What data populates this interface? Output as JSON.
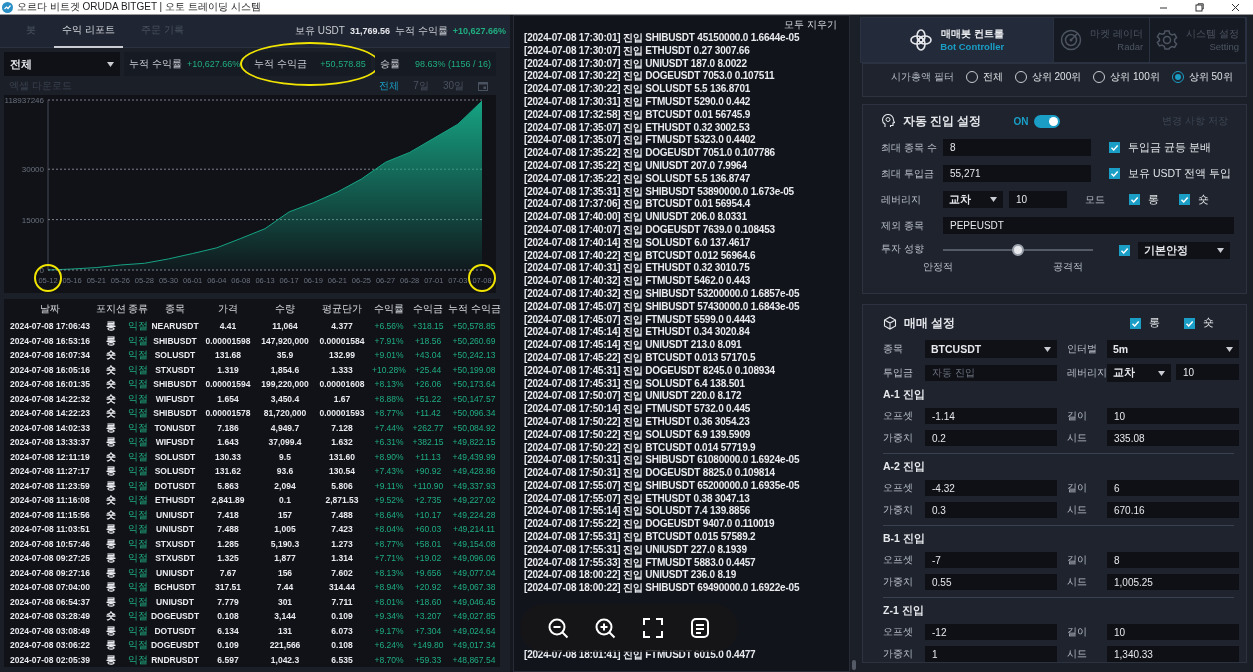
{
  "window": {
    "title": "오르다 비트겟 ORUDA BITGET | 오토 트레이딩 시스템",
    "controls": [
      {
        "kind": "minimize"
      },
      {
        "kind": "maximize"
      },
      {
        "kind": "close"
      }
    ]
  },
  "report": {
    "tabs": [
      {
        "label": "봇",
        "selected": false
      },
      {
        "label": "수익 리포트",
        "selected": true
      },
      {
        "label": "주문 기록",
        "selected": false
      }
    ],
    "balance": {
      "label": "보유 USDT",
      "value": "31,769.56"
    },
    "total_return": {
      "label": "누적 수익률",
      "value": "+10,627.66%"
    },
    "filter": {
      "value": "전체"
    },
    "stats": [
      {
        "label": "누적 수익률",
        "value": "+10,627.66%",
        "circled": false
      },
      {
        "label": "누적 수익금",
        "value": "+50,578.85",
        "circled": true
      },
      {
        "label": "승률",
        "value": "98.63% (1156 / 16)",
        "circled": false
      }
    ],
    "export_link": "엑셀 다운로드",
    "ranges": [
      {
        "label": "전체",
        "selected": true
      },
      {
        "label": "7일",
        "selected": false
      },
      {
        "label": "30일",
        "selected": false
      }
    ],
    "chart_data": {
      "type": "area",
      "categories": [
        "05-12",
        "05-16",
        "05-21",
        "05-26",
        "05-28",
        "05-30",
        "06-01",
        "06-04",
        "06-08",
        "06-13",
        "06-17",
        "06-19",
        "06-21",
        "06-25",
        "06-27",
        "06-28",
        "07-01",
        "07-03",
        "07-08"
      ],
      "series": [
        {
          "color": "#16a383",
          "values": [
            0,
            300,
            700,
            1500,
            2000,
            3300,
            4900,
            6600,
            9400,
            12300,
            17300,
            20000,
            23200,
            27100,
            32100,
            35000,
            39200,
            43400,
            50300
          ]
        }
      ],
      "ylim": [
        0,
        50600
      ],
      "yticks": [
        0,
        15000,
        30000
      ]
    },
    "chart_top_label": "118937246",
    "x_label_marks": [
      {
        "circled": true
      },
      {
        "circled": false
      },
      {
        "circled": false
      },
      {
        "circled": false
      },
      {
        "circled": false
      },
      {
        "circled": false
      },
      {
        "circled": false
      },
      {
        "circled": false
      },
      {
        "circled": false
      },
      {
        "circled": false
      },
      {
        "circled": false
      },
      {
        "circled": false
      },
      {
        "circled": false
      },
      {
        "circled": false
      },
      {
        "circled": false
      },
      {
        "circled": false
      },
      {
        "circled": false
      },
      {
        "circled": false
      },
      {
        "circled": true
      }
    ],
    "table": {
      "columns": [
        {
          "label": "날짜",
          "kind": "plain"
        },
        {
          "label": "포지션",
          "kind": "plain"
        },
        {
          "label": "종류",
          "kind": "profit"
        },
        {
          "label": "종목",
          "kind": "plain"
        },
        {
          "label": "가격",
          "kind": "plain"
        },
        {
          "label": "수량",
          "kind": "plain"
        },
        {
          "label": "평균단가",
          "kind": "plain"
        },
        {
          "label": "수익률",
          "kind": "profit"
        },
        {
          "label": "수익금",
          "kind": "profit"
        },
        {
          "label": "누적 수익금",
          "kind": "profit"
        }
      ],
      "rows": [
        [
          "2024-07-08 17:06:43",
          "롱",
          "익절",
          "NEARUSDT",
          "4.41",
          "11,064",
          "4.377",
          "+6.56%",
          "+318.15",
          "+50,578.85"
        ],
        [
          "2024-07-08 16:53:16",
          "롱",
          "익절",
          "SHIBUSDT",
          "0.00001598",
          "147,920,000",
          "0.00001584",
          "+7.91%",
          "+18.56",
          "+50,260.69"
        ],
        [
          "2024-07-08 16:07:34",
          "숏",
          "익절",
          "SOLUSDT",
          "131.68",
          "35.9",
          "132.99",
          "+9.01%",
          "+43.04",
          "+50,242.13"
        ],
        [
          "2024-07-08 16:05:16",
          "숏",
          "익절",
          "STXUSDT",
          "1.319",
          "1,854.6",
          "1.333",
          "+10.28%",
          "+25.44",
          "+50,199.08"
        ],
        [
          "2024-07-08 16:01:35",
          "숏",
          "익절",
          "SHIBUSDT",
          "0.00001594",
          "199,220,000",
          "0.00001608",
          "+8.13%",
          "+26.06",
          "+50,173.64"
        ],
        [
          "2024-07-08 14:22:32",
          "숏",
          "익절",
          "WIFUSDT",
          "1.654",
          "3,450.4",
          "1.67",
          "+8.88%",
          "+51.22",
          "+50,147.57"
        ],
        [
          "2024-07-08 14:22:23",
          "숏",
          "익절",
          "SHIBUSDT",
          "0.00001578",
          "81,720,000",
          "0.00001593",
          "+8.77%",
          "+11.42",
          "+50,096.34"
        ],
        [
          "2024-07-08 14:02:33",
          "롱",
          "익절",
          "TONUSDT",
          "7.186",
          "4,949.7",
          "7.128",
          "+7.44%",
          "+262.77",
          "+50,084.92"
        ],
        [
          "2024-07-08 13:33:37",
          "롱",
          "익절",
          "WIFUSDT",
          "1.643",
          "37,099.4",
          "1.632",
          "+6.31%",
          "+382.15",
          "+49,822.15"
        ],
        [
          "2024-07-08 12:11:19",
          "숏",
          "익절",
          "SOLUSDT",
          "130.33",
          "9.5",
          "131.60",
          "+8.90%",
          "+11.13",
          "+49,439.99"
        ],
        [
          "2024-07-08 11:27:17",
          "롱",
          "익절",
          "SOLUSDT",
          "131.62",
          "93.6",
          "130.54",
          "+7.43%",
          "+90.92",
          "+49,428.86"
        ],
        [
          "2024-07-08 11:23:59",
          "롱",
          "익절",
          "DOTUSDT",
          "5.863",
          "2,094",
          "5.806",
          "+9.11%",
          "+110.90",
          "+49,337.93"
        ],
        [
          "2024-07-08 11:16:08",
          "숏",
          "익절",
          "ETHUSDT",
          "2,841.89",
          "0.1",
          "2,871.53",
          "+9.52%",
          "+2.735",
          "+49,227.02"
        ],
        [
          "2024-07-08 11:15:56",
          "숏",
          "익절",
          "UNIUSDT",
          "7.418",
          "157",
          "7.488",
          "+8.64%",
          "+10.17",
          "+49,224.28"
        ],
        [
          "2024-07-08 11:03:51",
          "롱",
          "익절",
          "UNIUSDT",
          "7.488",
          "1,005",
          "7.423",
          "+8.04%",
          "+60.03",
          "+49,214.11"
        ],
        [
          "2024-07-08 10:57:46",
          "롱",
          "익절",
          "STXUSDT",
          "1.285",
          "5,190.3",
          "1.273",
          "+8.77%",
          "+58.01",
          "+49,154.08"
        ],
        [
          "2024-07-08 09:27:25",
          "롱",
          "익절",
          "STXUSDT",
          "1.325",
          "1,877",
          "1.314",
          "+7.71%",
          "+19.02",
          "+49,096.06"
        ],
        [
          "2024-07-08 09:27:16",
          "롱",
          "익절",
          "UNIUSDT",
          "7.67",
          "156",
          "7.602",
          "+8.13%",
          "+9.656",
          "+49,077.04"
        ],
        [
          "2024-07-08 07:04:00",
          "롱",
          "익절",
          "BCHUSDT",
          "317.51",
          "7.44",
          "314.44",
          "+8.94%",
          "+20.92",
          "+49,067.38"
        ],
        [
          "2024-07-08 06:54:37",
          "롱",
          "익절",
          "UNIUSDT",
          "7.779",
          "301",
          "7.711",
          "+8.01%",
          "+18.60",
          "+49,046.45"
        ],
        [
          "2024-07-08 03:28:49",
          "숏",
          "익절",
          "DOGEUSDT",
          "0.108",
          "3,144",
          "0.109",
          "+9.34%",
          "+3.207",
          "+49,027.85"
        ],
        [
          "2024-07-08 03:08:49",
          "롱",
          "익절",
          "DOTUSDT",
          "6.134",
          "131",
          "6.073",
          "+9.17%",
          "+7.304",
          "+49,024.64"
        ],
        [
          "2024-07-08 03:06:22",
          "롱",
          "익절",
          "DOGEUSDT",
          "0.109",
          "221,566",
          "0.108",
          "+6.24%",
          "+149.80",
          "+49,017.34"
        ],
        [
          "2024-07-08 02:05:39",
          "롱",
          "익절",
          "RNDRUSDT",
          "6.597",
          "1,042.3",
          "6.535",
          "+8.70%",
          "+59.33",
          "+48,867.54"
        ]
      ]
    }
  },
  "log": {
    "clear_button": "모두 지우기",
    "lines": [
      "[2024-07-08 17:30:01] 진입 SHIBUSDT 45150000.0 1.6644e-05",
      "[2024-07-08 17:30:07] 진입 ETHUSDT 0.27 3007.66",
      "[2024-07-08 17:30:07] 진입 UNIUSDT 187.0 8.0022",
      "[2024-07-08 17:30:22] 진입 DOGEUSDT 7053.0 0.107511",
      "[2024-07-08 17:30:22] 진입 SOLUSDT 5.5 136.8701",
      "[2024-07-08 17:30:31] 진입 FTMUSDT 5290.0 0.442",
      "[2024-07-08 17:32:58] 진입 BTCUSDT 0.01 56745.9",
      "[2024-07-08 17:35:07] 진입 ETHUSDT 0.32 3002.53",
      "[2024-07-08 17:35:07] 진입 FTMUSDT 5323.0 0.4402",
      "[2024-07-08 17:35:22] 진입 DOGEUSDT 7051.0 0.107786",
      "[2024-07-08 17:35:22] 진입 UNIUSDT 207.0 7.9964",
      "[2024-07-08 17:35:22] 진입 SOLUSDT 5.5 136.8747",
      "[2024-07-08 17:35:31] 진입 SHIBUSDT 53890000.0 1.673e-05",
      "[2024-07-08 17:37:06] 진입 BTCUSDT 0.01 56954.4",
      "[2024-07-08 17:40:00] 진입 UNIUSDT 206.0 8.0331",
      "[2024-07-08 17:40:07] 진입 DOGEUSDT 7639.0 0.108453",
      "[2024-07-08 17:40:14] 진입 SOLUSDT 6.0 137.4617",
      "[2024-07-08 17:40:22] 진입 BTCUSDT 0.012 56964.6",
      "[2024-07-08 17:40:31] 진입 ETHUSDT 0.32 3010.75",
      "[2024-07-08 17:40:32] 진입 FTMUSDT 5462.0 0.443",
      "[2024-07-08 17:40:32] 진입 SHIBUSDT 53200000.0 1.6857e-05",
      "[2024-07-08 17:45:07] 진입 SHIBUSDT 57430000.0 1.6843e-05",
      "[2024-07-08 17:45:07] 진입 FTMUSDT 5599.0 0.4443",
      "[2024-07-08 17:45:14] 진입 ETHUSDT 0.34 3020.84",
      "[2024-07-08 17:45:14] 진입 UNIUSDT 213.0 8.091",
      "[2024-07-08 17:45:22] 진입 BTCUSDT 0.013 57170.5",
      "[2024-07-08 17:45:31] 진입 DOGEUSDT 8245.0 0.108934",
      "[2024-07-08 17:45:31] 진입 SOLUSDT 6.4 138.501",
      "[2024-07-08 17:50:07] 진입 UNIUSDT 220.0 8.172",
      "[2024-07-08 17:50:14] 진입 FTMUSDT 5732.0 0.445",
      "[2024-07-08 17:50:22] 진입 ETHUSDT 0.36 3054.23",
      "[2024-07-08 17:50:22] 진입 SOLUSDT 6.9 139.5909",
      "[2024-07-08 17:50:22] 진입 BTCUSDT 0.014 57719.9",
      "[2024-07-08 17:50:31] 진입 SHIBUSDT 61080000.0 1.6924e-05",
      "[2024-07-08 17:50:31] 진입 DOGEUSDT 8825.0 0.109814",
      "[2024-07-08 17:55:07] 진입 SHIBUSDT 65200000.0 1.6935e-05",
      "[2024-07-08 17:55:07] 진입 ETHUSDT 0.38 3047.13",
      "[2024-07-08 17:55:14] 진입 SOLUSDT 7.4 139.8856",
      "[2024-07-08 17:55:22] 진입 DOGEUSDT 9407.0 0.110019",
      "[2024-07-08 17:55:31] 진입 BTCUSDT 0.015 57589.2",
      "[2024-07-08 17:55:31] 진입 UNIUSDT 227.0 8.1939",
      "[2024-07-08 17:55:33] 진입 FTMUSDT 5883.0 0.4457",
      "[2024-07-08 18:00:22] 진입 UNIUSDT 236.0 8.19",
      "[2024-07-08 18:00:22] 진입 SHIBUSDT 69490000.0 1.6922e-05",
      "[2024-07-08 18:01:41] 진입 FTMUSDT 6015.0 0.4477"
    ]
  },
  "viewer_toolbar": [
    {
      "kind": "zoom-out"
    },
    {
      "kind": "zoom-in"
    },
    {
      "kind": "fullscreen"
    },
    {
      "kind": "notes"
    }
  ],
  "controller": {
    "nav": [
      {
        "title": "매매봇 컨트롤",
        "subtitle": "Bot Controller",
        "selected": true
      },
      {
        "title": "마켓 레이더",
        "subtitle": "Radar",
        "selected": false
      },
      {
        "title": "시스템 설정",
        "subtitle": "Setting",
        "selected": false
      }
    ],
    "market_cap_filter": {
      "label": "시가총액 필터",
      "options": [
        {
          "label": "전체",
          "selected": false
        },
        {
          "label": "상위 200위",
          "selected": false
        },
        {
          "label": "상위 100위",
          "selected": false
        },
        {
          "label": "상위 50위",
          "selected": true
        }
      ]
    },
    "auto_entry": {
      "title": "자동 진입 설정",
      "toggle": {
        "label": "ON",
        "on": true
      },
      "save_button": "변경 사항 저장",
      "max_symbols": {
        "label": "최대 종목 수",
        "value": "8"
      },
      "split": {
        "label": "투입금 균등 분배",
        "checked": true
      },
      "max_invest": {
        "label": "최대 투입금",
        "value": "55,271"
      },
      "all_in": {
        "label": "보유 USDT 전액 투입",
        "checked": true
      },
      "leverage": {
        "label": "레버리지",
        "mode": "교차",
        "value": "10"
      },
      "mode": {
        "label": "모드",
        "options": [
          {
            "label": "롱",
            "checked": true
          },
          {
            "label": "숏",
            "checked": true
          }
        ]
      },
      "exclude": {
        "label": "제외 종목",
        "value": "PEPEUSDT"
      },
      "risk": {
        "label": "투자 성향",
        "level": 0.5,
        "min_label": "안정적",
        "max_label": "공격적",
        "preset_enabled": true,
        "preset": "기본안정"
      }
    },
    "trade": {
      "title": "매매 설정",
      "sides": [
        {
          "label": "롱",
          "checked": true
        },
        {
          "label": "숏",
          "checked": true
        }
      ],
      "symbol": {
        "label": "종목",
        "value": "BTCUSDT"
      },
      "interval": {
        "label": "인터벌",
        "value": "5m"
      },
      "amount": {
        "label": "투입금",
        "placeholder": "자동 진입"
      },
      "leverage": {
        "label": "레버리지",
        "mode": "교차",
        "value": "10"
      },
      "entries": [
        {
          "title": "A-1 진입",
          "fields": [
            {
              "label": "오프셋",
              "value": "-1.14"
            },
            {
              "label": "길이",
              "value": "10"
            },
            {
              "label": "가중치",
              "value": "0.2"
            },
            {
              "label": "시드",
              "value": "335.08"
            }
          ]
        },
        {
          "title": "A-2 진입",
          "fields": [
            {
              "label": "오프셋",
              "value": "-4.32"
            },
            {
              "label": "길이",
              "value": "6"
            },
            {
              "label": "가중치",
              "value": "0.3"
            },
            {
              "label": "시드",
              "value": "670.16"
            }
          ]
        },
        {
          "title": "B-1 진입",
          "fields": [
            {
              "label": "오프셋",
              "value": "-7"
            },
            {
              "label": "길이",
              "value": "8"
            },
            {
              "label": "가중치",
              "value": "0.55"
            },
            {
              "label": "시드",
              "value": "1,005.25"
            }
          ]
        },
        {
          "title": "Z-1 진입",
          "fields": [
            {
              "label": "오프셋",
              "value": "-12"
            },
            {
              "label": "길이",
              "value": "10"
            },
            {
              "label": "가중치",
              "value": "1"
            },
            {
              "label": "시드",
              "value": "1,340.33"
            }
          ]
        }
      ]
    }
  }
}
